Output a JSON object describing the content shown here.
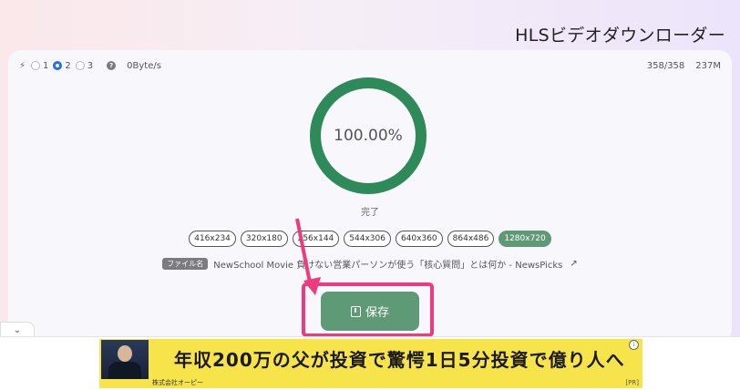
{
  "app": {
    "title": "HLSビデオダウンローダー"
  },
  "topbar": {
    "thread_options": [
      {
        "label": "1",
        "selected": false
      },
      {
        "label": "2",
        "selected": true
      },
      {
        "label": "3",
        "selected": false
      }
    ],
    "help": "?",
    "speed": "0Byte/s",
    "segments": "358/358",
    "size": "237M"
  },
  "progress": {
    "percent_label": "100.00%",
    "fraction": 1.0,
    "status": "完了",
    "color": "#2f8a5a"
  },
  "resolutions": [
    {
      "label": "416x234",
      "active": false
    },
    {
      "label": "320x180",
      "active": false
    },
    {
      "label": "256x144",
      "active": false
    },
    {
      "label": "544x306",
      "active": false
    },
    {
      "label": "640x360",
      "active": false
    },
    {
      "label": "864x486",
      "active": false
    },
    {
      "label": "1280x720",
      "active": true
    }
  ],
  "file": {
    "badge": "ファイル名",
    "name": "NewSchool Movie 負けない営業パーソンが使う「核心質問」とは何か - NewsPicks",
    "open_icon": "external-link-icon"
  },
  "save": {
    "label": "保存",
    "icon": "download-icon"
  },
  "annotation": {
    "color": "#ee3a7e"
  },
  "ad": {
    "headline": "年収200万の父が投資で驚愕1日5分投資で億り人へ",
    "company": "株式会社オーピー",
    "pr": "[PR]",
    "info": "i",
    "collapse_icon": "chevron-down-icon"
  }
}
